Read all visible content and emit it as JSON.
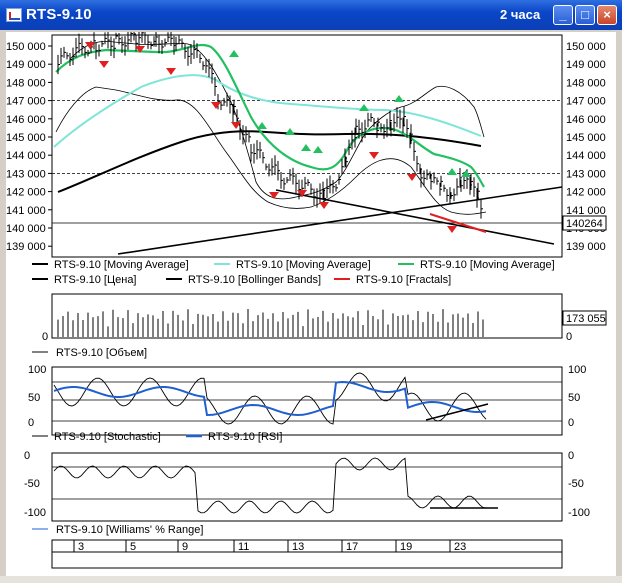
{
  "window": {
    "title": "RTS-9.10",
    "period": "2 часа",
    "minimize_label": "_",
    "maximize_label": "□",
    "close_label": "×"
  },
  "price_panel": {
    "y_ticks": [
      "150 000",
      "149 000",
      "148 000",
      "147 000",
      "146 000",
      "145 000",
      "144 000",
      "143 000",
      "142 000",
      "141 000",
      "140 000",
      "139 000"
    ],
    "y_ticks_left": [
      "150 000",
      "149 000",
      "148 000",
      "147 000",
      "146 000",
      "145 000",
      "144 000",
      "143 000",
      "142 000",
      "141 000",
      "140 000",
      "139 000"
    ],
    "current_price": "140264",
    "legend": [
      {
        "label": "RTS-9.10 [Moving Average]",
        "color": "#000000"
      },
      {
        "label": "RTS-9.10 [Moving Average]",
        "color": "#7fe5d8"
      },
      {
        "label": "RTS-9.10 [Moving Average]",
        "color": "#22c060"
      },
      {
        "label": "RTS-9.10 [Цена]",
        "color": "#000000"
      },
      {
        "label": "RTS-9.10 [Bollinger Bands]",
        "color": "#000000"
      },
      {
        "label": "RTS-9.10 [Fractals]",
        "color": "#e02020"
      }
    ]
  },
  "volume_panel": {
    "y_left": "0",
    "y_right_top": "173 055",
    "y_right_bottom": "0",
    "legend": "RTS-9.10 [Объем]"
  },
  "oscillator_panel": {
    "y_left": [
      "100",
      "50",
      "0"
    ],
    "y_right": [
      "100",
      "50",
      "0"
    ],
    "legend": [
      {
        "label": "RTS-9.10 [Stochastic]",
        "color": "#000000"
      },
      {
        "label": "RTS-9.10 [RSI]",
        "color": "#1f5fd0"
      }
    ]
  },
  "williams_panel": {
    "y_left": [
      "0",
      "-50",
      "-100"
    ],
    "y_right": [
      "0",
      "-50",
      "-100"
    ],
    "legend": "RTS-9.10 [Williams' % Range]"
  },
  "x_axis": {
    "labels": [
      "3",
      "5",
      "9",
      "11",
      "13",
      "17",
      "19",
      "23"
    ]
  },
  "colors": {
    "title_bar": "#0a46c8",
    "ma_cyan": "#7fe5d8",
    "ma_green": "#22c060",
    "fractal_up": "#22c060",
    "fractal_down": "#e02020",
    "rsi": "#1f5fd0"
  }
}
